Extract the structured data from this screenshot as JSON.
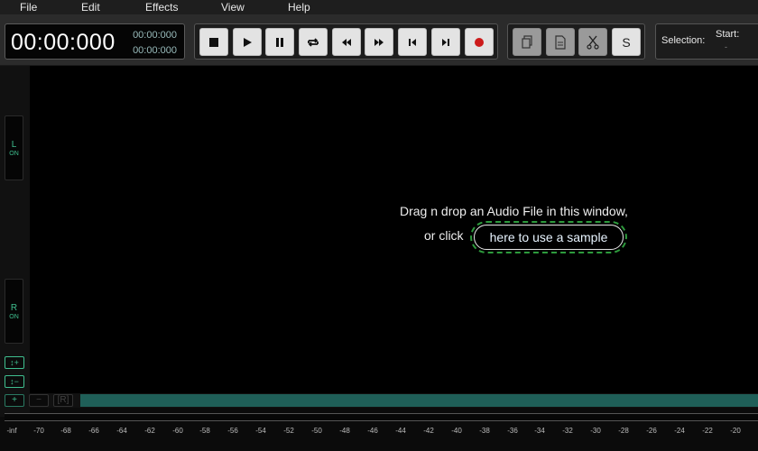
{
  "menu": [
    "File",
    "Edit",
    "Effects",
    "View",
    "Help"
  ],
  "clock": {
    "main": "00:00:000",
    "sub_top": "00:00:000",
    "sub_bottom": "00:00:000"
  },
  "transport_buttons": [
    "stop",
    "play",
    "pause",
    "loop",
    "rewind",
    "fast-forward",
    "skip-to-start",
    "skip-to-end",
    "record"
  ],
  "edit_buttons": [
    "copy",
    "paste",
    "cut"
  ],
  "edit_s_label": "S",
  "selection": {
    "label": "Selection:",
    "start_label": "Start:",
    "start_value": "-"
  },
  "channels": {
    "left": {
      "letter": "L",
      "state": "ON"
    },
    "right": {
      "letter": "R",
      "state": "ON"
    }
  },
  "zoom": {
    "in": "↕+",
    "out": "↕−"
  },
  "bottom": {
    "add": "+",
    "remove": "−",
    "r": "[R]"
  },
  "drop": {
    "line1": "Drag n drop an Audio File in this window,",
    "line2": "or click",
    "sample_button": "here to use a sample"
  },
  "meter_ticks": [
    "-inf",
    "-70",
    "-68",
    "-66",
    "-64",
    "-62",
    "-60",
    "-58",
    "-56",
    "-54",
    "-52",
    "-50",
    "-48",
    "-46",
    "-44",
    "-42",
    "-40",
    "-38",
    "-36",
    "-34",
    "-32",
    "-30",
    "-28",
    "-26",
    "-24",
    "-22",
    "-20"
  ],
  "colors": {
    "accent": "#3fbf8f",
    "scrollbar": "#1f5f58",
    "record": "#cc1a1a",
    "sample_outline": "#2d9a3c"
  }
}
